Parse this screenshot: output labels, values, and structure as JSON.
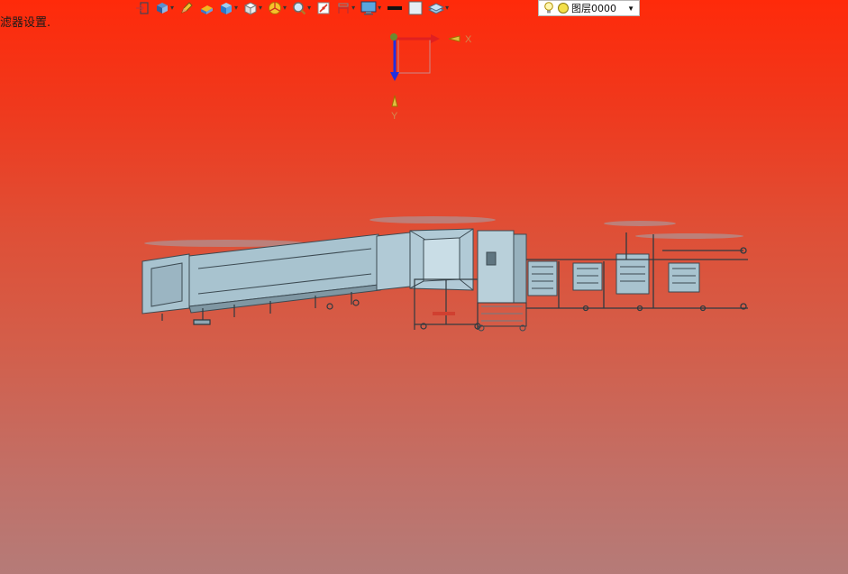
{
  "status": {
    "text": "滤器设置."
  },
  "toolbar": {
    "items": [
      {
        "icon": "exit-sketch-icon"
      },
      {
        "icon": "view-orientation-icon",
        "dropdown": true
      },
      {
        "icon": "pencil-icon"
      },
      {
        "icon": "materials-icon"
      },
      {
        "icon": "display-style-icon",
        "dropdown": true
      },
      {
        "icon": "hide-show-icon",
        "dropdown": true
      },
      {
        "icon": "appearance-icon",
        "dropdown": true
      },
      {
        "icon": "zoom-icon",
        "dropdown": true
      },
      {
        "icon": "section-view-icon"
      },
      {
        "icon": "dimension-icon",
        "dropdown": true
      },
      {
        "icon": "monitor-icon",
        "dropdown": true
      },
      {
        "icon": "line-color-icon"
      },
      {
        "icon": "fill-color-icon"
      },
      {
        "icon": "layer-stack-icon",
        "dropdown": true
      }
    ]
  },
  "layer": {
    "name": "图层0000"
  },
  "triad": {
    "x_label": "X",
    "y_label": "Y"
  },
  "colors": {
    "accent": "#1f4fd8",
    "axis_x": "#e02020",
    "axis_y": "#2030e0",
    "model": "#a8c3cf"
  }
}
